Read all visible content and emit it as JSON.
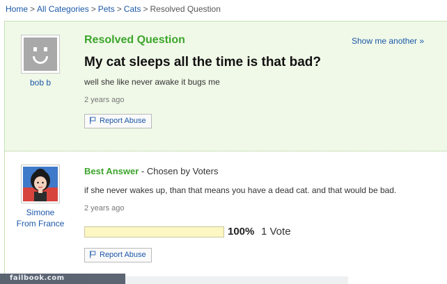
{
  "breadcrumb": {
    "items": [
      "Home",
      "All Categories",
      "Pets",
      "Cats"
    ],
    "current": "Resolved Question",
    "separator": ">"
  },
  "question": {
    "status_label": "Resolved Question",
    "show_another_label": "Show me another »",
    "title": "My cat sleeps all the time is that bad?",
    "body": "well she like never awake it bugs me",
    "time_ago": "2 years ago",
    "report_label": "Report Abuse",
    "asker": {
      "name": "bob b",
      "avatar_icon": "default-smiley-avatar"
    }
  },
  "best_answer": {
    "label": "Best Answer",
    "chosen_by": " - Chosen by Voters",
    "body": "if she never wakes up, than that means you have a dead cat. and that would be bad.",
    "time_ago": "2 years ago",
    "vote_fraction": 1.0,
    "vote_percent": "100%",
    "vote_count": "1 Vote",
    "report_label": "Report Abuse",
    "answerer": {
      "name_line1": "Simone",
      "name_line2": "From France",
      "avatar_icon": "girl-avatar"
    }
  },
  "footer": {
    "watermark": "failbook.com"
  },
  "colors": {
    "accent_green": "#3ca52c",
    "link_blue": "#1b57a8",
    "panel_green": "#f0f9e8",
    "vote_bar_yellow": "#fff9bf"
  }
}
